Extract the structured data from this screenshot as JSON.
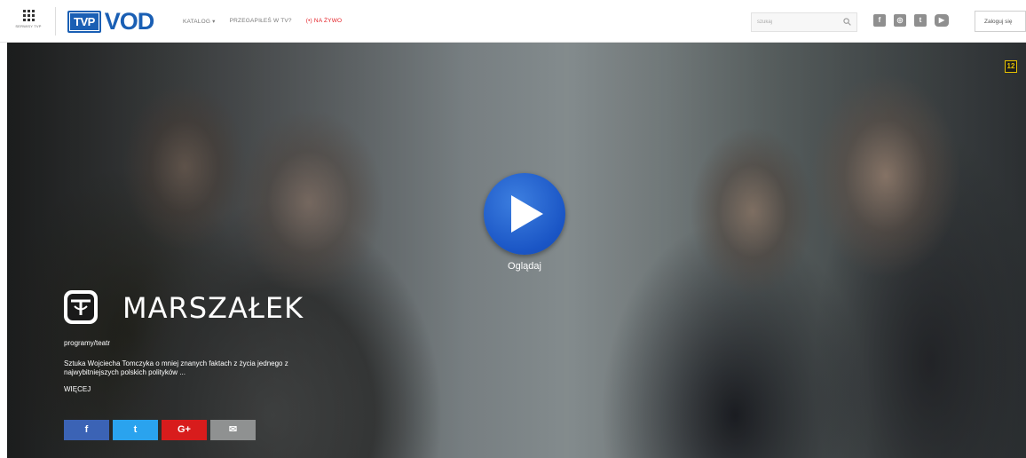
{
  "header": {
    "serwisy_label": "SERWISY TVP",
    "logo_tvp": "TVP",
    "logo_vod": "VOD",
    "nav": [
      {
        "label": "KATALOG ▾"
      },
      {
        "label": "PRZEGAPIŁEŚ W TV?"
      },
      {
        "label": "(•) NA ŻYWO"
      }
    ],
    "search_placeholder": "szukaj",
    "social": [
      {
        "icon": "facebook-icon",
        "glyph": "f"
      },
      {
        "icon": "instagram-icon",
        "glyph": "◎"
      },
      {
        "icon": "twitter-icon",
        "glyph": "t"
      },
      {
        "icon": "youtube-icon",
        "glyph": "▶"
      }
    ],
    "login_label": "Zaloguj się"
  },
  "hero": {
    "age_rating": "12",
    "play_label": "Oglądaj",
    "title": "MARSZAŁEK",
    "category": "programy/teatr",
    "description": "Sztuka Wojciecha Tomczyka o mniej znanych faktach z życia jednego z najwybitniejszych polskich polityków ...",
    "more_label": "WIĘCEJ",
    "share": [
      {
        "icon": "facebook-icon",
        "glyph": "f",
        "color": "#3b63b5"
      },
      {
        "icon": "twitter-icon",
        "glyph": "t",
        "color": "#2aa3ee"
      },
      {
        "icon": "google-plus-icon",
        "glyph": "G+",
        "color": "#d81c1c"
      },
      {
        "icon": "mail-icon",
        "glyph": "✉",
        "color": "#8f9191"
      }
    ]
  },
  "colors": {
    "brand_blue": "#1a5fb4",
    "live_red": "#e31e24",
    "age_badge_yellow": "#e8c200"
  }
}
